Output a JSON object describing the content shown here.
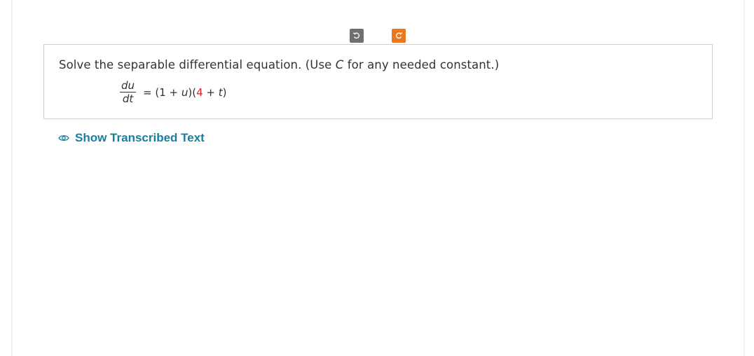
{
  "toolbar": {
    "undo_icon": "undo-icon",
    "redo_icon": "redo-icon",
    "redo_color": "#e8791f",
    "undo_color": "#6f6f6f"
  },
  "question": {
    "prompt_part1": "Solve the separable differential equation. (Use ",
    "prompt_var": "C",
    "prompt_part2": " for any needed constant.)",
    "equation": {
      "numerator": "du",
      "denominator": "dt",
      "rhs_part1": "= (1 + ",
      "rhs_var_u": "u",
      "rhs_part2": ")(",
      "rhs_highlight": "4",
      "rhs_part3": " + ",
      "rhs_var_t": "t",
      "rhs_part4": ")",
      "highlight_color": "#e0231c"
    }
  },
  "link": {
    "label": "Show Transcribed Text",
    "icon": "eye-icon",
    "color": "#157fa0"
  }
}
